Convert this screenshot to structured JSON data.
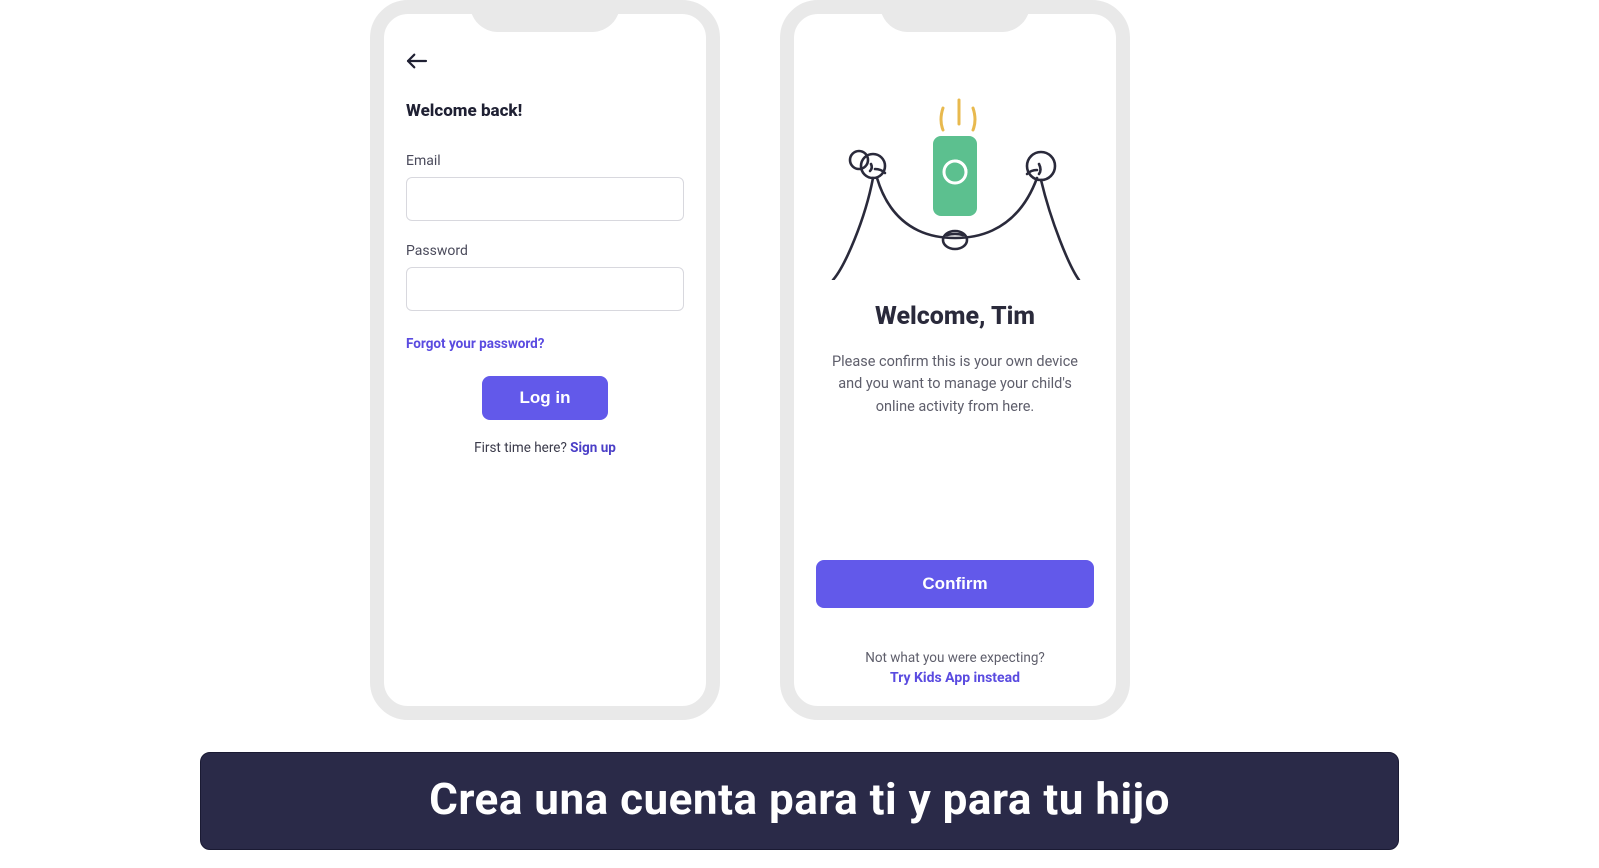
{
  "left": {
    "heading": "Welcome back!",
    "email_label": "Email",
    "password_label": "Password",
    "forgot": "Forgot your password?",
    "login_button": "Log in",
    "signup_prefix": "First time here? ",
    "signup_link": "Sign up"
  },
  "right": {
    "title": "Welcome, Tim",
    "body": "Please confirm this is your own device and you want to manage your child's online activity from here.",
    "confirm_button": "Confirm",
    "alt_prefix": "Not what you were expecting?",
    "alt_link": "Try Kids App instead"
  },
  "caption": "Crea una cuenta para ti y para tu hijo",
  "colors": {
    "accent": "#6259ea",
    "link": "#5a4be0",
    "caption_bg": "#2a2a48",
    "illus_green": "#5cc08f",
    "illus_yellow": "#e8b94e"
  }
}
